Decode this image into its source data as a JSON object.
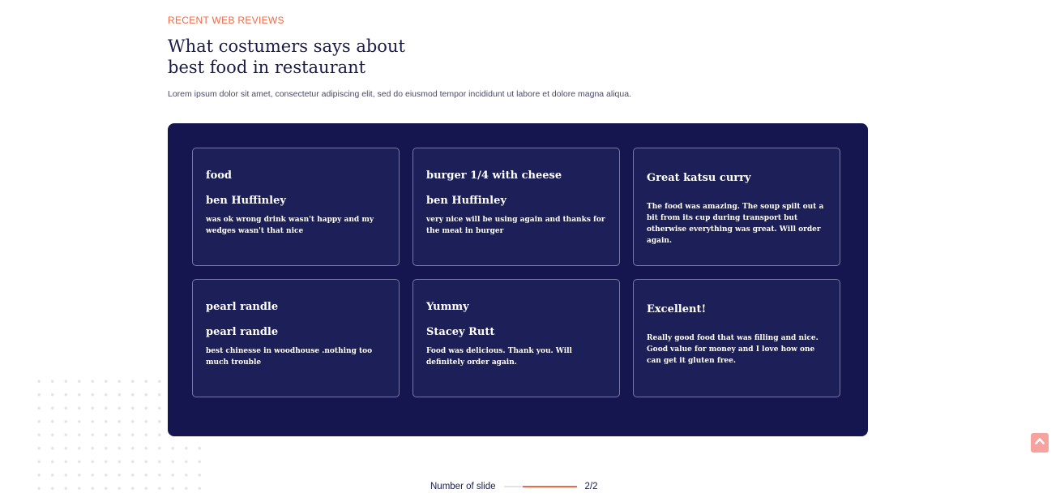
{
  "section": {
    "eyebrow": "RECENT WEB REVIEWS",
    "heading": "What costumers says about best food in restaurant",
    "lead": "Lorem ipsum dolor sit amet, consectetur adipiscing elit, sed do eiusmod tempor incididunt ut labore et dolore magna aliqua."
  },
  "reviews": [
    {
      "title": "food",
      "author": "ben Huffinley",
      "text": "was ok wrong drink wasn't happy and my wedges wasn't that nice"
    },
    {
      "title": "burger 1/4 with cheese",
      "author": "ben Huffinley",
      "text": "very nice will be using again and thanks for the meat in burger"
    },
    {
      "title": "Great katsu curry",
      "author": "",
      "text": "The food was amazing. The soup spilt out a bit from its cup during transport but otherwise everything was great. Will order again."
    },
    {
      "title": "pearl randle",
      "author": "pearl randle",
      "text": "best chinesse in woodhouse .nothing too much trouble"
    },
    {
      "title": "Yummy",
      "author": "Stacey Rutt",
      "text": "Food was delicious. Thank you. Will definitely order again."
    },
    {
      "title": "Excellent!",
      "author": "",
      "text": "Really good food that was filling and nice. Good value for money and I love how one can get it gluten free."
    }
  ],
  "slider": {
    "label": "Number of slide",
    "counter": "2/2",
    "current": 2,
    "total": 2
  },
  "icons": {
    "scroll_top": "chevron-up-icon"
  },
  "colors": {
    "accent": "#ee6a45",
    "panel": "#151650",
    "card": "#1d1f58",
    "scroll_top": "#f6a3a0"
  }
}
